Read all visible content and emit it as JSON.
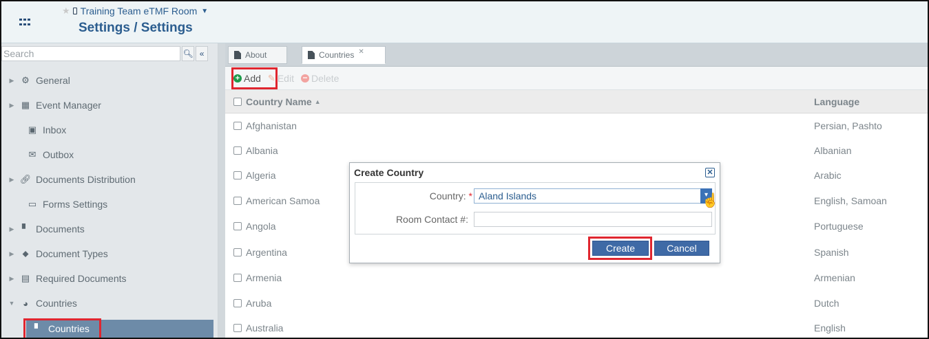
{
  "header": {
    "room_name": "Training Team eTMF Room",
    "page_title": "Settings / Settings"
  },
  "sidebar": {
    "search_placeholder": "Search",
    "items": [
      {
        "label": "General",
        "icon": "gears-icon",
        "expandable": true
      },
      {
        "label": "Event Manager",
        "icon": "calendar-icon",
        "expandable": true
      },
      {
        "label": "Inbox",
        "icon": "inbox-icon",
        "expandable": false
      },
      {
        "label": "Outbox",
        "icon": "envelope-icon",
        "expandable": false
      },
      {
        "label": "Documents Distribution",
        "icon": "link-icon",
        "expandable": true
      },
      {
        "label": "Forms Settings",
        "icon": "form-icon",
        "expandable": false
      },
      {
        "label": "Documents",
        "icon": "document-icon",
        "expandable": true
      },
      {
        "label": "Document Types",
        "icon": "tag-icon",
        "expandable": true
      },
      {
        "label": "Required Documents",
        "icon": "clipboard-icon",
        "expandable": true
      },
      {
        "label": "Countries",
        "icon": "globe-icon",
        "expandable": true,
        "expanded": true
      }
    ],
    "sub_item": {
      "label": "Countries",
      "icon": "document-icon"
    }
  },
  "tabs": [
    {
      "label": "About",
      "active": false
    },
    {
      "label": "Countries",
      "active": true
    }
  ],
  "toolbar": {
    "add_label": "Add",
    "edit_label": "Edit",
    "delete_label": "Delete"
  },
  "grid": {
    "columns": [
      "Country Name",
      "Language"
    ],
    "rows": [
      {
        "name": "Afghanistan",
        "language": "Persian, Pashto"
      },
      {
        "name": "Albania",
        "language": "Albanian"
      },
      {
        "name": "Algeria",
        "language": "Arabic"
      },
      {
        "name": "American Samoa",
        "language": "English, Samoan"
      },
      {
        "name": "Angola",
        "language": "Portuguese"
      },
      {
        "name": "Argentina",
        "language": "Spanish"
      },
      {
        "name": "Armenia",
        "language": "Armenian"
      },
      {
        "name": "Aruba",
        "language": "Dutch"
      },
      {
        "name": "Australia",
        "language": "English"
      }
    ]
  },
  "dialog": {
    "title": "Create Country",
    "country_label": "Country:",
    "country_value": "Aland Islands",
    "room_contact_label": "Room Contact #:",
    "room_contact_value": "",
    "create_label": "Create",
    "cancel_label": "Cancel"
  },
  "colors": {
    "highlight": "#e0262f",
    "primary": "#3f6aa6",
    "selected_nav": "#6d8ba8"
  }
}
